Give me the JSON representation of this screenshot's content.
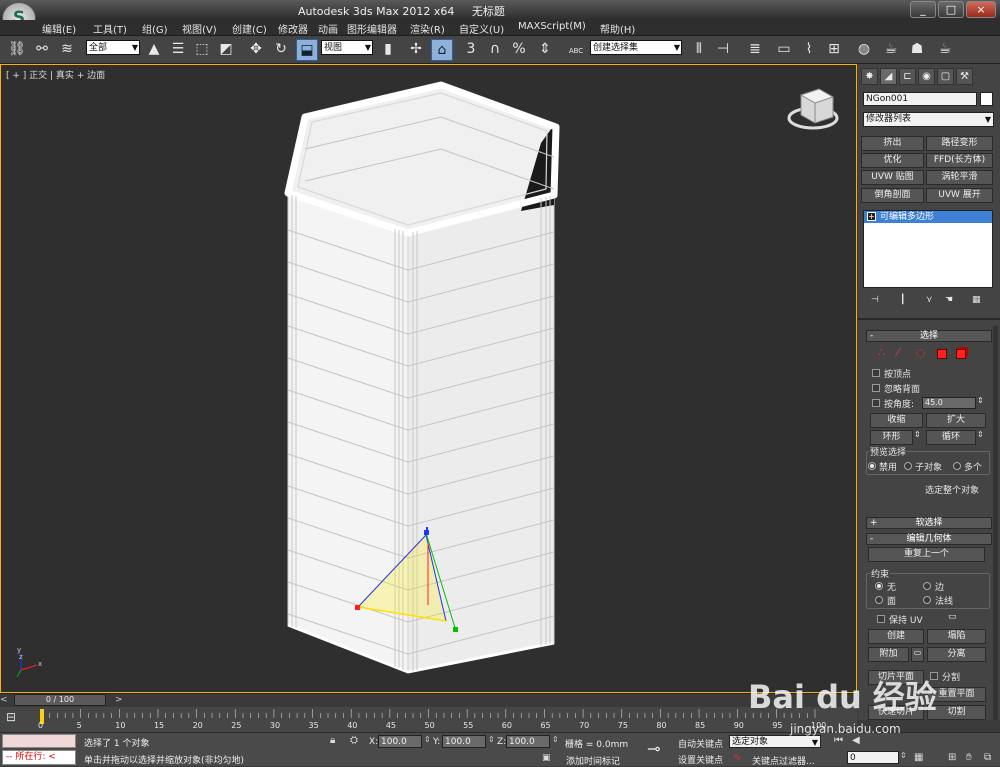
{
  "window": {
    "app_title": "Autodesk 3ds Max  2012 x64",
    "doc_title": "无标题",
    "logo": "3ds-max-logo",
    "min": "_",
    "max": "□",
    "close": "×"
  },
  "menu": [
    "编辑(E)",
    "工具(T)",
    "组(G)",
    "视图(V)",
    "创建(C)",
    "修改器",
    "动画",
    "图形编辑器",
    "渲染(R)",
    "自定义(U)",
    "MAXScript(M)",
    "帮助(H)"
  ],
  "toolbar": {
    "filter_value": "全部",
    "coord_value": "视图",
    "named_sel": "创建选择集",
    "snap3": "3",
    "snap_pct": "%",
    "abc": "ABC"
  },
  "viewport": {
    "label": "[ + ] 正交 | 真实 + 边面",
    "gizmo_axis_z": "z",
    "gizmo_axis_x": "x",
    "mini_axis_y": "y",
    "mini_axis_x": "x",
    "mini_axis_z": "z"
  },
  "panel": {
    "object_name": "NGon001",
    "modifier_list": "修改器列表",
    "mod_buttons": [
      "挤出",
      "路径变形",
      "优化",
      "FFD(长方体)",
      "UVW 贴图",
      "涡轮平滑",
      "倒角剖面",
      "UVW 展开"
    ],
    "stack_item": "可编辑多边形",
    "select_title": "选择",
    "by_vertex": "按顶点",
    "ignore_back": "忽略背面",
    "by_angle": "按角度:",
    "angle_value": "45.0",
    "shrink": "收缩",
    "grow": "扩大",
    "ring": "环形",
    "loop": "循环",
    "preview_title": "预览选择",
    "preview_opts": [
      "禁用",
      "子对象",
      "多个"
    ],
    "select_whole": "选定整个对象",
    "soft_title": "软选择",
    "edit_geom_title": "编辑几何体",
    "repeat_last": "重复上一个",
    "constraint_title": "约束",
    "constraint_opts": [
      "无",
      "边",
      "面",
      "法线"
    ],
    "keep_uv": "保持 UV",
    "create": "创建",
    "collapse": "塌陷",
    "attach": "附加",
    "detach": "分离",
    "slice_plane": "切片平面",
    "split": "分割",
    "reset_plane": "重置平面",
    "quickslice": "快速切片",
    "cut": "切割"
  },
  "timeline": {
    "frame_counter": "0 / 100",
    "ticks": [
      "0",
      "5",
      "10",
      "15",
      "20",
      "25",
      "30",
      "35",
      "40",
      "45",
      "50",
      "55",
      "60",
      "65",
      "70",
      "75",
      "80",
      "85",
      "90",
      "95",
      "100"
    ]
  },
  "status": {
    "script_label": "所在行:",
    "selected": "选择了 1 个对象",
    "prompt": "单击并拖动以选择并缩放对象(非均匀地)",
    "x_label": "X:",
    "x_value": "100.0",
    "y_label": "Y:",
    "y_value": "100.0",
    "z_label": "Z:",
    "z_value": "100.0",
    "grid": "栅格 = 0.0mm",
    "add_time_tag": "添加时间标记",
    "auto_key": "自动关键点",
    "auto_key_sel": "选定对象",
    "set_key": "设置关键点",
    "key_filters": "关键点过滤器...",
    "frame_value": "0"
  },
  "watermark": {
    "brand": "Bai du 经验",
    "url": "jingyan.baidu.com"
  }
}
